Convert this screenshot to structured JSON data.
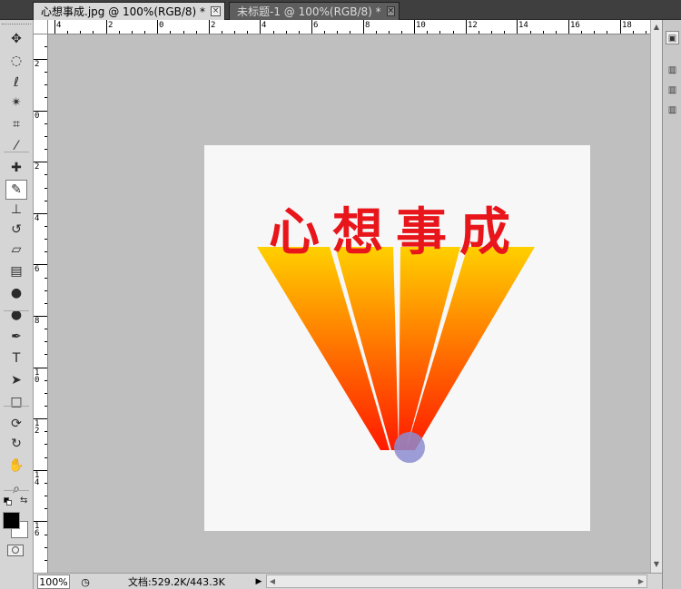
{
  "tabs": [
    {
      "label": "心想事成.jpg @ 100%(RGB/8) *",
      "close": "×",
      "active": true
    },
    {
      "label": "未标题-1 @ 100%(RGB/8) *",
      "close": "×",
      "active": false
    }
  ],
  "ruler": {
    "horizontal": [
      "4",
      "2",
      "0",
      "2",
      "4",
      "6",
      "8",
      "10",
      "12",
      "14",
      "16",
      "18"
    ],
    "vertical": [
      "2",
      "0",
      "2",
      "4",
      "6",
      "8",
      "10",
      "12",
      "14",
      "16"
    ]
  },
  "artwork": {
    "text": "心想事成",
    "text_color": "#e8151b",
    "ray_colors": [
      "#ffd000",
      "#ff6a00",
      "#ff1a00"
    ],
    "circle_color": "#8c8cd0"
  },
  "status": {
    "zoom": "100%",
    "doc_info": "文档:529.2K/443.3K",
    "arrow": "▶"
  },
  "tools": [
    {
      "name": "move-tool-icon",
      "glyph": "✥"
    },
    {
      "name": "marquee-tool-icon",
      "glyph": "◌"
    },
    {
      "name": "lasso-tool-icon",
      "glyph": "ℓ"
    },
    {
      "name": "magic-wand-tool-icon",
      "glyph": "✴"
    },
    {
      "name": "crop-tool-icon",
      "glyph": "⌗"
    },
    {
      "name": "eyedropper-tool-icon",
      "glyph": "⁄"
    },
    {
      "name": "healing-brush-tool-icon",
      "glyph": "✚"
    },
    {
      "name": "brush-tool-icon",
      "glyph": "✎"
    },
    {
      "name": "stamp-tool-icon",
      "glyph": "⊥"
    },
    {
      "name": "history-brush-tool-icon",
      "glyph": "↺"
    },
    {
      "name": "eraser-tool-icon",
      "glyph": "▱"
    },
    {
      "name": "gradient-tool-icon",
      "glyph": "▤"
    },
    {
      "name": "blur-tool-icon",
      "glyph": "●"
    },
    {
      "name": "dodge-tool-icon",
      "glyph": "●"
    },
    {
      "name": "pen-tool-icon",
      "glyph": "✒"
    },
    {
      "name": "type-tool-icon",
      "glyph": "T"
    },
    {
      "name": "path-selection-tool-icon",
      "glyph": "➤"
    },
    {
      "name": "shape-tool-icon",
      "glyph": "□"
    },
    {
      "name": "3d-rotate-tool-icon",
      "glyph": "⟳"
    },
    {
      "name": "3d-orbit-tool-icon",
      "glyph": "↻"
    },
    {
      "name": "hand-tool-icon",
      "glyph": "✋"
    },
    {
      "name": "zoom-tool-icon",
      "glyph": "⌕"
    }
  ],
  "colors": {
    "foreground": "#000000",
    "background": "#ffffff"
  }
}
